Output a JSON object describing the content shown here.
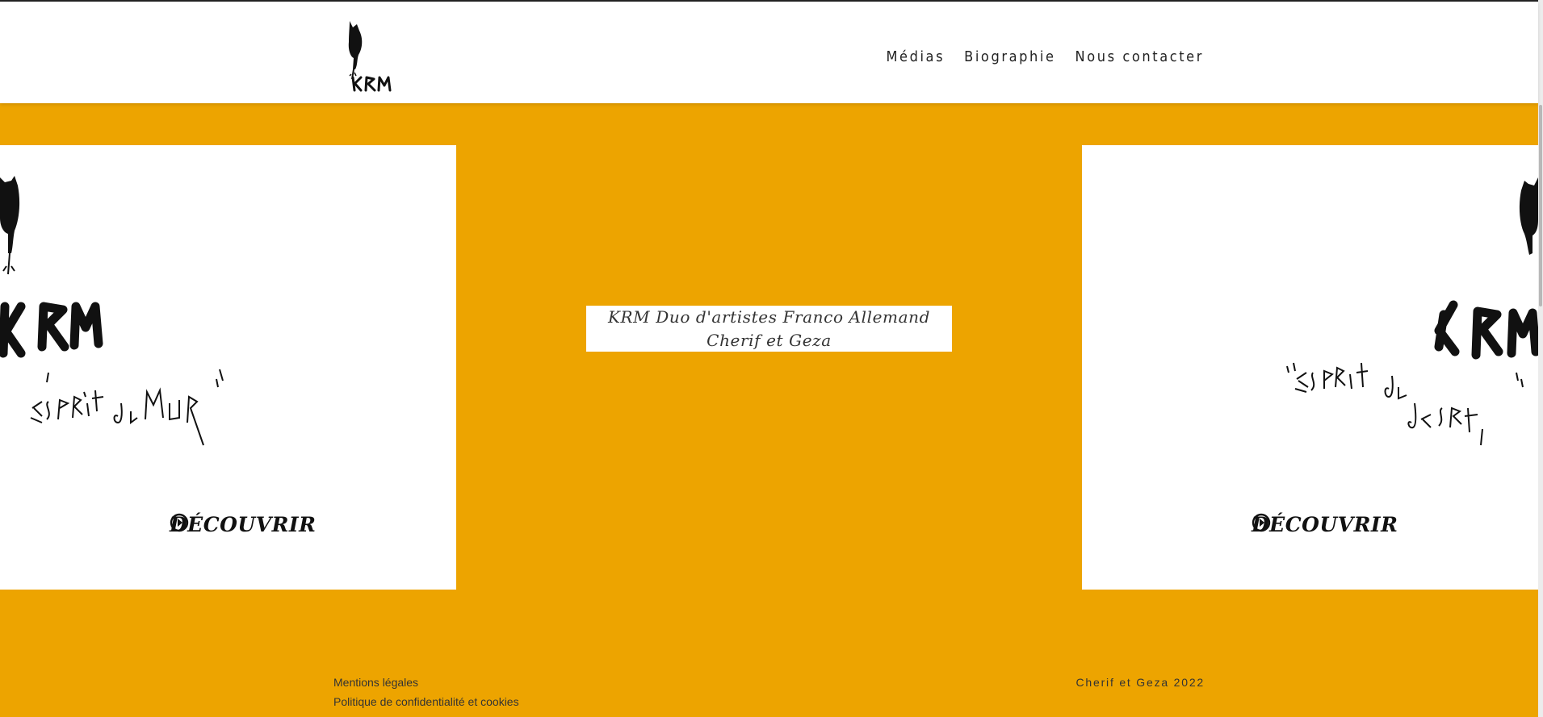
{
  "nav": {
    "items": [
      {
        "label": "Médias"
      },
      {
        "label": "Biographie"
      },
      {
        "label": "Nous contacter"
      }
    ]
  },
  "cards": {
    "left": {
      "art_text": "\"ESPRIT du MUR\"",
      "cta_label": "DÉCOUVRIR"
    },
    "right": {
      "art_text": "\"ESPRIT du DESERT\"",
      "cta_label": "DÉCOUVRIR"
    }
  },
  "intro": {
    "line1": "KRM Duo d'artistes Franco Allemand",
    "line2": "Cherif et Geza"
  },
  "footer": {
    "legal": "Mentions légales",
    "privacy": "Politique de confidentialité et cookies",
    "copyright": "Cherif et Geza 2022"
  },
  "colors": {
    "accent": "#EDA400",
    "text": "#222222",
    "background": "#ffffff"
  },
  "logo_text": "KRM"
}
